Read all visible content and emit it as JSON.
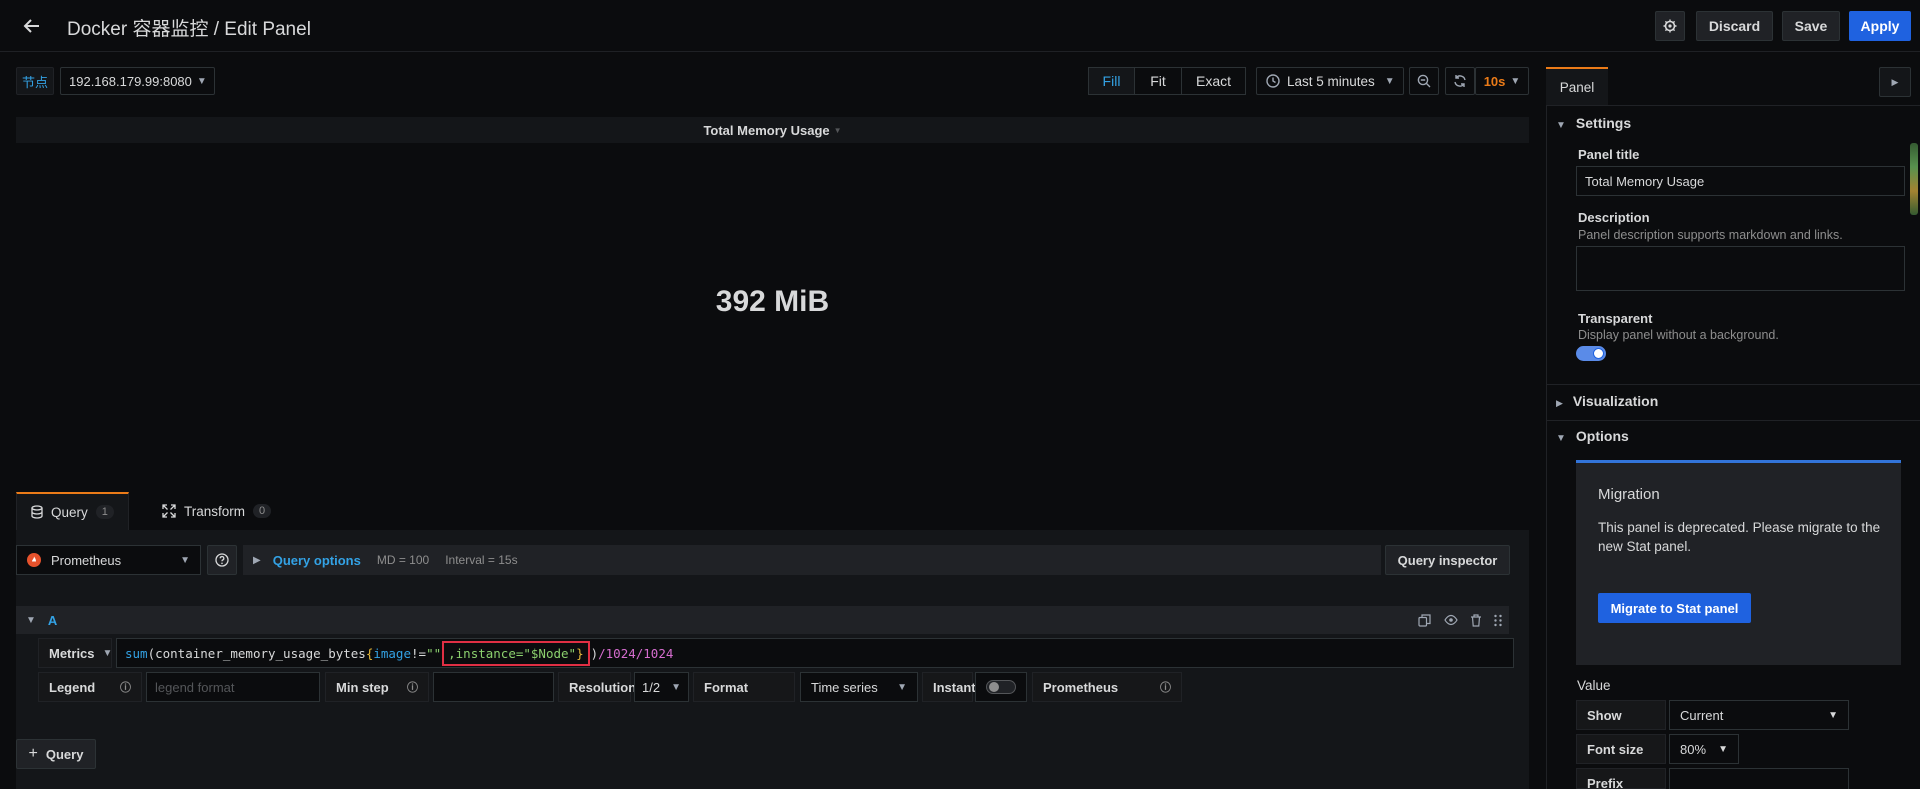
{
  "header": {
    "title": "Docker 容器监控 / Edit Panel",
    "discard_label": "Discard",
    "save_label": "Save",
    "apply_label": "Apply"
  },
  "toolbar": {
    "variable_label": "节点",
    "variable_value": "192.168.179.99:8080",
    "view_modes": [
      "Fill",
      "Fit",
      "Exact"
    ],
    "active_view_mode": "Fill",
    "time_range": "Last 5 minutes",
    "refresh_interval": "10s"
  },
  "panel": {
    "title": "Total Memory Usage",
    "value": "392 MiB"
  },
  "tabs": [
    {
      "label": "Query",
      "count": "1"
    },
    {
      "label": "Transform",
      "count": "0"
    }
  ],
  "query": {
    "datasource": "Prometheus",
    "options_label": "Query options",
    "md": "MD = 100",
    "interval": "Interval = 15s",
    "inspector_label": "Query inspector",
    "refid": "A",
    "metrics_label": "Metrics",
    "expr_parts": {
      "fn": "sum",
      "open": "(",
      "metric": "container_memory_usage_bytes",
      "brace_open": "{",
      "label1": "image",
      "op1": "!=",
      "val1": "\"\"",
      "highlight": ",instance=\"$Node\"",
      "brace_close": "}",
      "close": ")",
      "tail": "/1024/1024"
    },
    "legend_label": "Legend",
    "legend_placeholder": "legend format",
    "minstep_label": "Min step",
    "resolution_label": "Resolution",
    "resolution_value": "1/2",
    "format_label": "Format",
    "format_value": "Time series",
    "instant_label": "Instant",
    "ds_badge": "Prometheus",
    "add_query_label": "Query"
  },
  "sidebar": {
    "tab_label": "Panel",
    "settings_label": "Settings",
    "panel_title_label": "Panel title",
    "panel_title_value": "Total Memory Usage",
    "description_label": "Description",
    "description_hint": "Panel description supports markdown and links.",
    "transparent_label": "Transparent",
    "transparent_hint": "Display panel without a background.",
    "visualization_label": "Visualization",
    "options_label": "Options",
    "migration_title": "Migration",
    "migration_text": "This panel is deprecated. Please migrate to the new Stat panel.",
    "migrate_button": "Migrate to Stat panel",
    "value_label": "Value",
    "show_label": "Show",
    "show_value": "Current",
    "fontsize_label": "Font size",
    "fontsize_value": "80%",
    "prefix_label": "Prefix"
  },
  "colors": {
    "accent_blue": "#1f62e0",
    "link_blue": "#33a2e5",
    "orange": "#eb7b18",
    "highlight_red": "#e02f44"
  },
  "icons": [
    "back-arrow-icon",
    "gear-icon",
    "clock-icon",
    "zoom-out-icon",
    "refresh-icon",
    "database-icon",
    "transform-icon",
    "help-icon",
    "chevron-right-icon",
    "copy-icon",
    "eye-icon",
    "trash-icon",
    "drag-icon",
    "info-icon",
    "plus-icon",
    "prometheus-logo-icon"
  ]
}
